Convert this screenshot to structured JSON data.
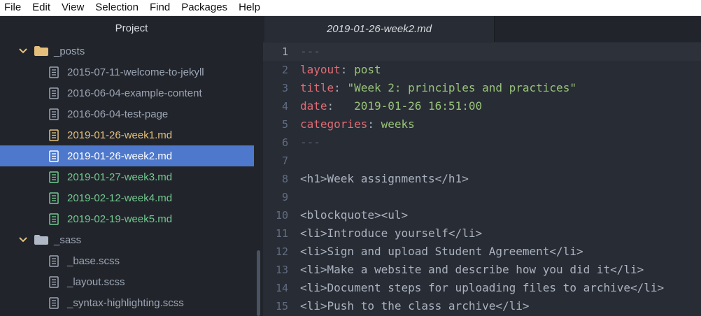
{
  "menubar": {
    "items": [
      "File",
      "Edit",
      "View",
      "Selection",
      "Find",
      "Packages",
      "Help"
    ]
  },
  "sidebar": {
    "header": "Project",
    "tree": [
      {
        "type": "folder",
        "label": "_posts",
        "state": "expanded"
      },
      {
        "type": "file",
        "label": "2015-07-11-welcome-to-jekyll",
        "status": "normal"
      },
      {
        "type": "file",
        "label": "2016-06-04-example-content",
        "status": "normal"
      },
      {
        "type": "file",
        "label": "2016-06-04-test-page",
        "status": "normal"
      },
      {
        "type": "file",
        "label": "2019-01-26-week1.md",
        "status": "modified"
      },
      {
        "type": "file",
        "label": "2019-01-26-week2.md",
        "status": "selected"
      },
      {
        "type": "file",
        "label": "2019-01-27-week3.md",
        "status": "added"
      },
      {
        "type": "file",
        "label": "2019-02-12-week4.md",
        "status": "added"
      },
      {
        "type": "file",
        "label": "2019-02-19-week5.md",
        "status": "added"
      },
      {
        "type": "folder",
        "label": "_sass",
        "state": "expanded"
      },
      {
        "type": "file",
        "label": "_base.scss",
        "status": "normal"
      },
      {
        "type": "file",
        "label": "_layout.scss",
        "status": "normal"
      },
      {
        "type": "file",
        "label": "_syntax-highlighting.scss",
        "status": "normal"
      }
    ]
  },
  "editor": {
    "tab_title": "2019-01-26-week2.md",
    "cursor_line": 1,
    "lines": [
      {
        "n": "1",
        "parts": [
          {
            "t": "---",
            "c": "c"
          }
        ]
      },
      {
        "n": "2",
        "parts": [
          {
            "t": "layout",
            "c": "k"
          },
          {
            "t": ": "
          },
          {
            "t": "post",
            "c": "s"
          }
        ]
      },
      {
        "n": "3",
        "parts": [
          {
            "t": "title",
            "c": "k"
          },
          {
            "t": ": "
          },
          {
            "t": "\"Week 2: principles and practices\"",
            "c": "s"
          }
        ]
      },
      {
        "n": "4",
        "parts": [
          {
            "t": "date",
            "c": "k"
          },
          {
            "t": ":   "
          },
          {
            "t": "2019-01-26 16:51:00",
            "c": "s"
          }
        ]
      },
      {
        "n": "5",
        "parts": [
          {
            "t": "categories",
            "c": "k"
          },
          {
            "t": ": "
          },
          {
            "t": "weeks",
            "c": "s"
          }
        ]
      },
      {
        "n": "6",
        "parts": [
          {
            "t": "---",
            "c": "c"
          }
        ]
      },
      {
        "n": "7",
        "parts": []
      },
      {
        "n": "8",
        "parts": [
          {
            "t": "<h1>Week assignments</h1>"
          }
        ]
      },
      {
        "n": "9",
        "parts": []
      },
      {
        "n": "10",
        "parts": [
          {
            "t": "<blockquote><ul>"
          }
        ]
      },
      {
        "n": "11",
        "parts": [
          {
            "t": "<li>Introduce yourself</li>"
          }
        ]
      },
      {
        "n": "12",
        "parts": [
          {
            "t": "<li>Sign and upload Student Agreement</li>"
          }
        ]
      },
      {
        "n": "13",
        "parts": [
          {
            "t": "<li>Make a website and describe how you did it</li>"
          }
        ]
      },
      {
        "n": "14",
        "parts": [
          {
            "t": "<li>Document steps for uploading files to archive</li>"
          }
        ]
      },
      {
        "n": "15",
        "parts": [
          {
            "t": "<li>Push to the class archive</li>"
          }
        ]
      }
    ]
  },
  "colors": {
    "selection": "#4d78cc",
    "modified": "#e5c07b",
    "added": "#73c990",
    "keyword": "#e06c75",
    "string": "#98c379"
  }
}
